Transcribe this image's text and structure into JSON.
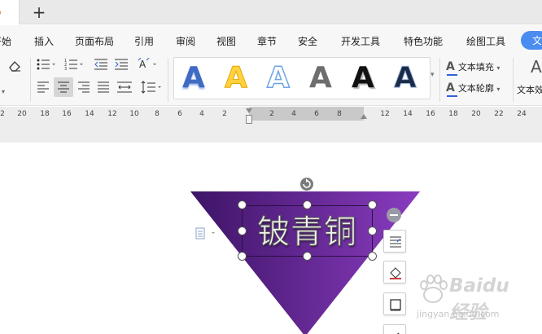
{
  "tabs": {
    "new_tab": "+"
  },
  "menu": {
    "items": [
      "开始",
      "插入",
      "页面布局",
      "引用",
      "审阅",
      "视图",
      "章节",
      "安全",
      "开发工具",
      "特色功能",
      "绘图工具",
      "文"
    ]
  },
  "ribbon": {
    "wordart_styles": [
      {
        "glyph": "A",
        "color": "#3f6bc2"
      },
      {
        "glyph": "A",
        "color": "#ffd23f"
      },
      {
        "glyph": "A",
        "color": "#ffffff"
      },
      {
        "glyph": "A",
        "color": "#6e6e6e"
      },
      {
        "glyph": "A",
        "color": "#111111"
      },
      {
        "glyph": "A",
        "color": "#1c2b4a"
      }
    ],
    "text_fill": "文本填充",
    "text_outline": "文本轮廓",
    "text_effect": "文本效",
    "more_arrow": "▾"
  },
  "ruler": {
    "left_ticks": [
      "2",
      "20",
      "18",
      "16",
      "14",
      "12",
      "10",
      "8",
      "6",
      "4",
      "2"
    ],
    "mid_ticks": [
      "2",
      "4",
      "6",
      "8"
    ],
    "right_ticks": [
      "12",
      "14",
      "16",
      "18",
      "20",
      "22",
      "24"
    ]
  },
  "document": {
    "wordart_text": "铍青铜",
    "shape_colors": {
      "left": "#3d1466",
      "right": "#8a3cc0"
    }
  },
  "watermark": {
    "brand": "Baidu经验",
    "url": "jingyan.baidu.com"
  }
}
